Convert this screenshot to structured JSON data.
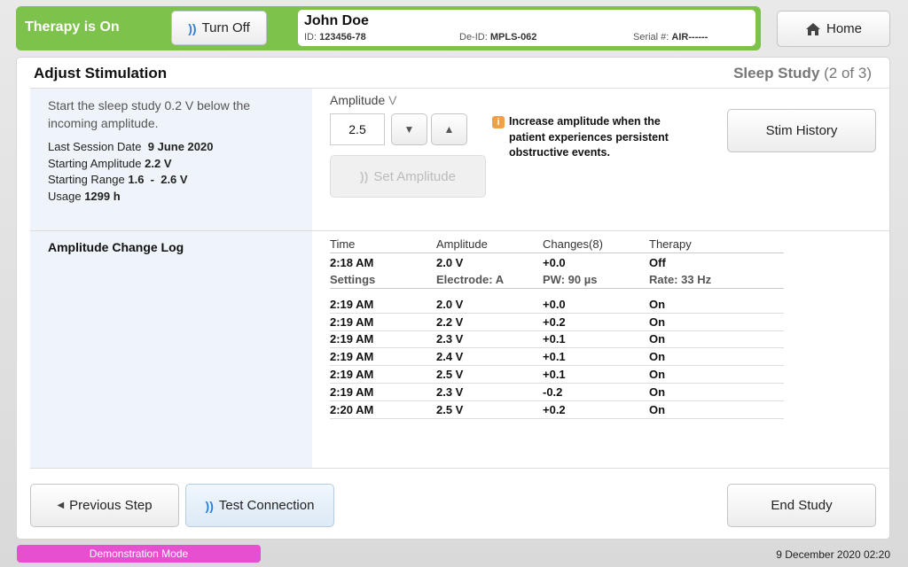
{
  "status_bar": {
    "therapy_status": "Therapy is On",
    "turn_off_label": "Turn Off",
    "patient": {
      "name": "John Doe",
      "id_label": "ID:",
      "id": "123456-78",
      "deid_label": "De-ID:",
      "deid": "MPLS-062",
      "serial_label": "Serial #:",
      "serial": "AIR------"
    },
    "home_label": "Home"
  },
  "header": {
    "title": "Adjust Stimulation",
    "step_name": "Sleep Study",
    "step_progress": "(2 of 3)"
  },
  "left": {
    "instruction": "Start the sleep study 0.2 V below the incoming amplitude.",
    "last_session_label": "Last Session Date",
    "last_session": "9 June 2020",
    "starting_amp_label": "Starting Amplitude",
    "starting_amp": "2.2 V",
    "starting_range_label": "Starting Range",
    "starting_range": "1.6  -  2.6 V",
    "usage_label": "Usage",
    "usage": "1299 h",
    "log_title": "Amplitude Change Log"
  },
  "amplitude": {
    "label": "Amplitude",
    "unit": "V",
    "value": "2.5",
    "down_glyph": "▼",
    "up_glyph": "▲",
    "set_label": "Set Amplitude",
    "info_text": "Increase amplitude when the patient experiences persistent obstructive events.",
    "stim_history_label": "Stim History"
  },
  "log": {
    "headers": [
      "Time",
      "Amplitude",
      "Changes(8)",
      "Therapy"
    ],
    "first": [
      "2:18 AM",
      "2.0 V",
      "+0.0",
      "Off"
    ],
    "settings": [
      "Settings",
      "Electrode: A",
      "PW: 90 µs",
      "Rate: 33 Hz"
    ],
    "rows": [
      [
        "2:19 AM",
        "2.0 V",
        "+0.0",
        "On"
      ],
      [
        "2:19 AM",
        "2.2 V",
        "+0.2",
        "On"
      ],
      [
        "2:19 AM",
        "2.3 V",
        "+0.1",
        "On"
      ],
      [
        "2:19 AM",
        "2.4 V",
        "+0.1",
        "On"
      ],
      [
        "2:19 AM",
        "2.5 V",
        "+0.1",
        "On"
      ],
      [
        "2:19 AM",
        "2.3 V",
        "-0.2",
        "On"
      ],
      [
        "2:20 AM",
        "2.5 V",
        "+0.2",
        "On"
      ]
    ]
  },
  "footer": {
    "prev_label": "Previous Step",
    "test_label": "Test Connection",
    "end_label": "End Study",
    "demo_mode": "Demonstration Mode",
    "datetime": "9 December 2020 02:20"
  },
  "colors": {
    "status_green": "#7cc24b",
    "accent_blue": "#2a7fd4",
    "info_orange": "#f0a04b",
    "demo_pink": "#e64fd0"
  },
  "icons": [
    "signal-waves-icon",
    "home-icon",
    "triangle-left-icon",
    "info-icon"
  ]
}
